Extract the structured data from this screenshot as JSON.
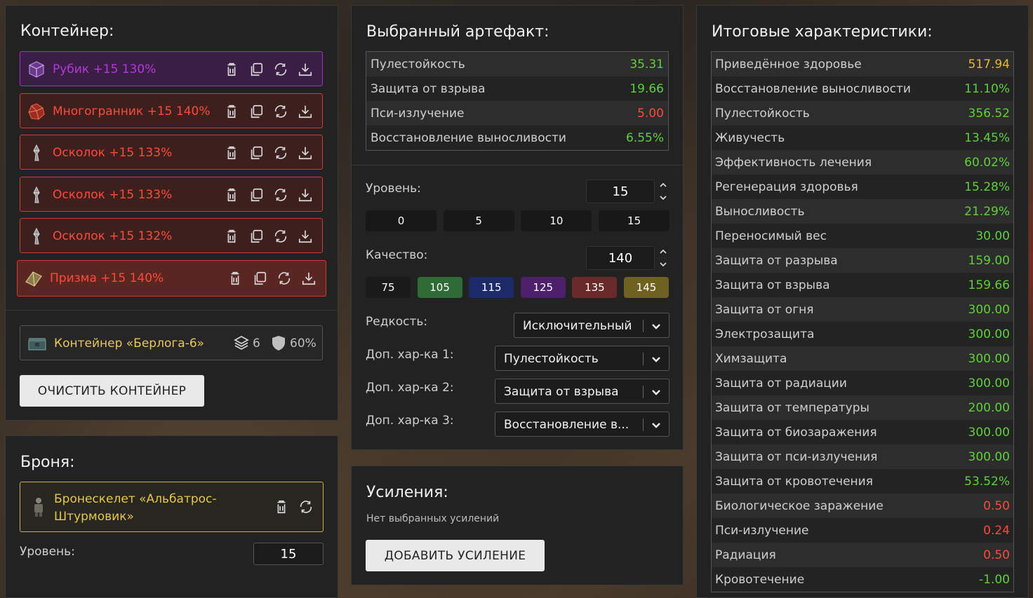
{
  "container_panel": {
    "title": "Контейнер:",
    "artifacts": [
      {
        "name": "Рубик +15 130%",
        "icon": "cube-artifact-icon",
        "color": "#b23ad6",
        "border": "#a52fd0",
        "bg": "#3a1e45"
      },
      {
        "name": "Многогранник +15 140%",
        "icon": "polyhedron-artifact-icon",
        "color": "#ff4a3a",
        "border": "#d23a2c",
        "bg": "#3d201d"
      },
      {
        "name": "Осколок +15 133%",
        "icon": "shard-artifact-icon",
        "color": "#ff4a3a",
        "border": "#d23a2c",
        "bg": "#3d201d"
      },
      {
        "name": "Осколок +15 133%",
        "icon": "shard-artifact-icon",
        "color": "#ff4a3a",
        "border": "#d23a2c",
        "bg": "#3d201d"
      },
      {
        "name": "Осколок +15 132%",
        "icon": "shard-artifact-icon",
        "color": "#ff4a3a",
        "border": "#d23a2c",
        "bg": "#3d201d"
      },
      {
        "name": "Призма +15 140%",
        "icon": "prism-artifact-icon",
        "color": "#ff4a3a",
        "border": "#d23a2c",
        "bg": "#5a2622"
      }
    ],
    "container_item": {
      "name": "Контейнер «Берлога-6»",
      "slots": "6",
      "protection": "60%"
    },
    "clear_button": "ОЧИСТИТЬ КОНТЕЙНЕР"
  },
  "armor_panel": {
    "title": "Броня:",
    "armor_name_line1": "Бронескелет «Альбатрос-",
    "armor_name_line2": "Штурмовик»",
    "armor_color": "#e6c84a",
    "level_label": "Уровень:",
    "level_value": "15"
  },
  "artifact_panel": {
    "title": "Выбранный артефакт:",
    "stats": [
      {
        "name": "Пулестойкость",
        "value": "35.31",
        "color": "#5fd03a"
      },
      {
        "name": "Защита от взрыва",
        "value": "19.66",
        "color": "#5fd03a"
      },
      {
        "name": "Пси-излучение",
        "value": "5.00",
        "color": "#ff4a3a"
      },
      {
        "name": "Восстановление выносливости",
        "value": "6.55%",
        "color": "#5fd03a"
      }
    ],
    "level_label": "Уровень:",
    "level_value": "15",
    "level_presets": [
      "0",
      "5",
      "10",
      "15"
    ],
    "quality_label": "Качество:",
    "quality_value": "140",
    "quality_presets": [
      {
        "label": "75",
        "color": "#1a1a1a"
      },
      {
        "label": "105",
        "color": "#2f6b35"
      },
      {
        "label": "115",
        "color": "#1c2a6a"
      },
      {
        "label": "125",
        "color": "#4e1f6a"
      },
      {
        "label": "135",
        "color": "#6a2a2a"
      },
      {
        "label": "145",
        "color": "#6f6120"
      }
    ],
    "rarity_label": "Редкость:",
    "rarity_value": "Исключительный",
    "extra1_label": "Доп. хар-ка 1:",
    "extra1_value": "Пулестойкость",
    "extra2_label": "Доп. хар-ка 2:",
    "extra2_value": "Защита от взрыва",
    "extra3_label": "Доп. хар-ка 3:",
    "extra3_value": "Восстановление в..."
  },
  "boost_panel": {
    "title": "Усиления:",
    "empty_text": "Нет выбранных усилений",
    "add_button": "ДОБАВИТЬ УСИЛЕНИЕ"
  },
  "totals_panel": {
    "title": "Итоговые характеристики:",
    "stats": [
      {
        "name": "Приведённое здоровье",
        "value": "517.94",
        "color": "#e6b82e"
      },
      {
        "name": "Восстановление выносливости",
        "value": "11.10%",
        "color": "#5fd03a"
      },
      {
        "name": "Пулестойкость",
        "value": "356.52",
        "color": "#5fd03a"
      },
      {
        "name": "Живучесть",
        "value": "13.45%",
        "color": "#5fd03a"
      },
      {
        "name": "Эффективность лечения",
        "value": "60.02%",
        "color": "#5fd03a"
      },
      {
        "name": "Регенерация здоровья",
        "value": "15.28%",
        "color": "#5fd03a"
      },
      {
        "name": "Выносливость",
        "value": "21.29%",
        "color": "#5fd03a"
      },
      {
        "name": "Переносимый вес",
        "value": "30.00",
        "color": "#5fd03a"
      },
      {
        "name": "Защита от разрыва",
        "value": "159.00",
        "color": "#5fd03a"
      },
      {
        "name": "Защита от взрыва",
        "value": "159.66",
        "color": "#5fd03a"
      },
      {
        "name": "Защита от огня",
        "value": "300.00",
        "color": "#5fd03a"
      },
      {
        "name": "Электрозащита",
        "value": "300.00",
        "color": "#5fd03a"
      },
      {
        "name": "Химзащита",
        "value": "300.00",
        "color": "#5fd03a"
      },
      {
        "name": "Защита от радиации",
        "value": "300.00",
        "color": "#5fd03a"
      },
      {
        "name": "Защита от температуры",
        "value": "200.00",
        "color": "#5fd03a"
      },
      {
        "name": "Защита от биозаражения",
        "value": "300.00",
        "color": "#5fd03a"
      },
      {
        "name": "Защита от пси-излучения",
        "value": "300.00",
        "color": "#5fd03a"
      },
      {
        "name": "Защита от кровотечения",
        "value": "53.52%",
        "color": "#5fd03a"
      },
      {
        "name": "Биологическое заражение",
        "value": "0.50",
        "color": "#ff4a3a"
      },
      {
        "name": "Пси-излучение",
        "value": "0.24",
        "color": "#ff4a3a"
      },
      {
        "name": "Радиация",
        "value": "0.50",
        "color": "#ff4a3a"
      },
      {
        "name": "Кровотечение",
        "value": "-1.00",
        "color": "#5fd03a"
      }
    ]
  }
}
